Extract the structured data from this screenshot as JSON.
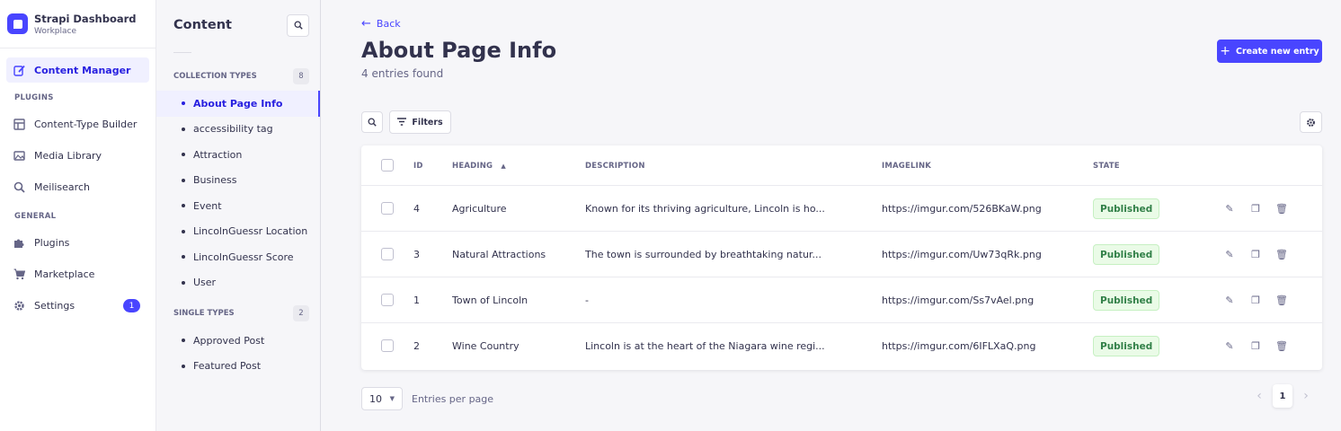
{
  "brand": {
    "title": "Strapi Dashboard",
    "subtitle": "Workplace"
  },
  "nav": {
    "content_manager": "Content Manager",
    "plugins_section": "PLUGINS",
    "content_type_builder": "Content-Type Builder",
    "media_library": "Media Library",
    "meilisearch": "Meilisearch",
    "general_section": "GENERAL",
    "plugins": "Plugins",
    "marketplace": "Marketplace",
    "settings": "Settings",
    "settings_badge": "1"
  },
  "subnav": {
    "title": "Content",
    "collection_types_label": "COLLECTION TYPES",
    "collection_types_count": "8",
    "collection_types": [
      "About Page Info",
      "accessibility tag",
      "Attraction",
      "Business",
      "Event",
      "LincolnGuessr Location",
      "LincolnGuessr Score",
      "User"
    ],
    "single_types_label": "SINGLE TYPES",
    "single_types_count": "2",
    "single_types": [
      "Approved Post",
      "Featured Post"
    ]
  },
  "header": {
    "back_label": "Back",
    "title": "About Page Info",
    "subtitle": "4 entries found",
    "create_label": "Create new entry"
  },
  "toolbar": {
    "filters_label": "Filters"
  },
  "table": {
    "columns": {
      "id": "ID",
      "heading": "HEADING",
      "description": "DESCRIPTION",
      "imagelink": "IMAGELINK",
      "state": "STATE"
    },
    "sort_indicator": "▲",
    "rows": [
      {
        "id": "4",
        "heading": "Agriculture",
        "description": "Known for its thriving agriculture, Lincoln is ho...",
        "imagelink": "https://imgur.com/526BKaW.png",
        "state": "Published"
      },
      {
        "id": "3",
        "heading": "Natural Attractions",
        "description": "The town is surrounded by breathtaking natur...",
        "imagelink": "https://imgur.com/Uw73qRk.png",
        "state": "Published"
      },
      {
        "id": "1",
        "heading": "Town of Lincoln",
        "description": "-",
        "imagelink": "https://imgur.com/Ss7vAel.png",
        "state": "Published"
      },
      {
        "id": "2",
        "heading": "Wine Country",
        "description": "Lincoln is at the heart of the Niagara wine regi...",
        "imagelink": "https://imgur.com/6IFLXaQ.png",
        "state": "Published"
      }
    ]
  },
  "footer": {
    "page_size": "10",
    "page_size_label": "Entries per page",
    "current_page": "1"
  },
  "colors": {
    "primary": "#4945ff",
    "published_bg": "#eafbe7",
    "published_text": "#328048"
  }
}
